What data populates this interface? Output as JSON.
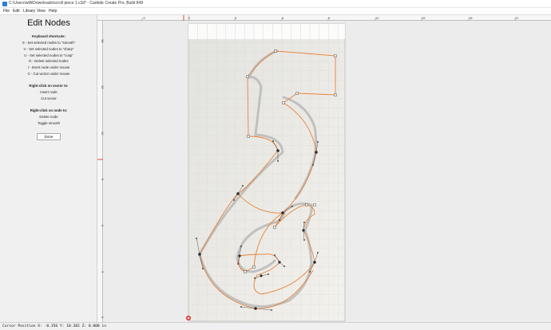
{
  "window": {
    "title": "C:\\Users\\willi\\Downloads\\scroll piece 1.c2d* - Carbide Create Pro, Build 849"
  },
  "menu": [
    "File",
    "Edit",
    "Library",
    "View",
    "Help"
  ],
  "panel": {
    "heading": "Edit Nodes",
    "shortcuts_title": "Keyboard shortcuts:",
    "shortcuts": [
      "S - Set selected nodes to \"smooth\"",
      "V - Set selected nodes to \"sharp\"",
      "U - Set selected nodes to \"cusp\"",
      "D - Delete selected nodes",
      "I - Insert node under mouse",
      "C - Cut vector under mouse"
    ],
    "vector_title": "Right-click on vector to:",
    "vector_actions": [
      "Insert node",
      "Cut vector"
    ],
    "node_title": "Right-click on node to:",
    "node_actions": [
      "Delete node",
      "Toggle smooth"
    ],
    "done_label": "Done"
  },
  "rulers": {
    "top_labels": [
      "-3",
      "0",
      "3",
      "6",
      "9",
      "12",
      "15",
      "18",
      "21"
    ],
    "left_labels": [
      "18",
      "15",
      "12",
      "9",
      "6",
      "3",
      "0"
    ]
  },
  "status": {
    "cursor": "Cursor Position X: -0.356 Y: 10.382 Z: 0.000 in"
  },
  "colors": {
    "accent_red": "#e0302a",
    "vector_orange": "#e8823a",
    "grid": "#cfcfcf"
  }
}
